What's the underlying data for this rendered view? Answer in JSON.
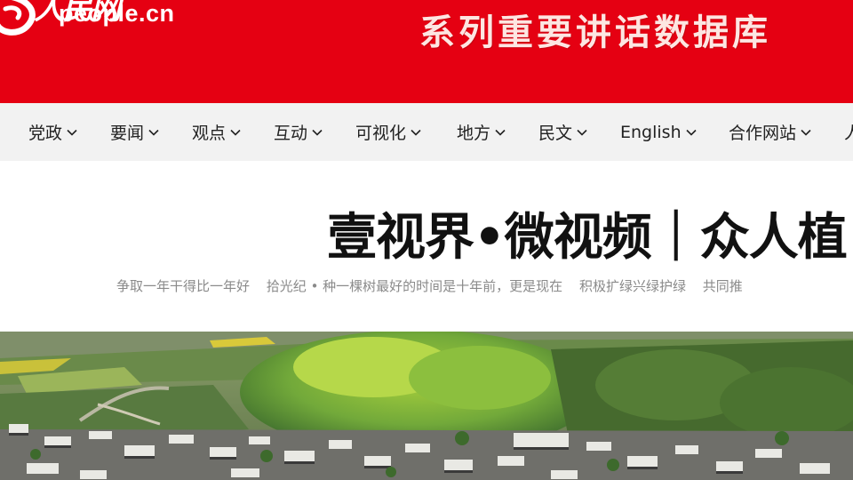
{
  "banner": {
    "logo_script": "人民网",
    "logo_domain": "people.cn",
    "slogan": "系列重要讲话数据库",
    "colors": {
      "brand_red": "#e50012",
      "slogan_text": "#fde6e2"
    }
  },
  "nav": {
    "items": [
      {
        "label": "党政",
        "icon": "chevron-down-icon"
      },
      {
        "label": "要闻",
        "icon": "chevron-down-icon"
      },
      {
        "label": "观点",
        "icon": "chevron-down-icon"
      },
      {
        "label": "互动",
        "icon": "chevron-down-icon"
      },
      {
        "label": "可视化",
        "icon": "chevron-down-icon"
      },
      {
        "label": "地方",
        "icon": "chevron-down-icon"
      },
      {
        "label": "民文",
        "icon": "chevron-down-icon"
      },
      {
        "label": "English",
        "icon": "chevron-down-icon"
      },
      {
        "label": "合作网站",
        "icon": "chevron-down-icon"
      },
      {
        "label": "人",
        "icon": ""
      }
    ]
  },
  "main": {
    "headline": "壹视界•微视频｜众人植",
    "ticker": [
      "争取一年干得比一年好",
      "拾光纪 • 种一棵树最好的时间是十年前，更是现在",
      "积极扩绿兴绿护绿",
      "共同推"
    ]
  }
}
